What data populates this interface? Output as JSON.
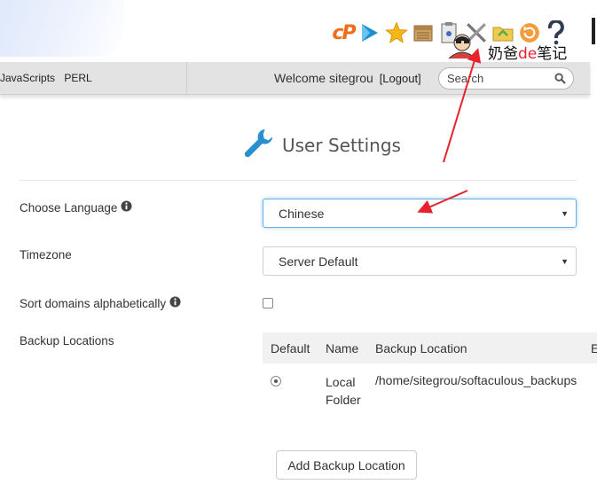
{
  "header": {
    "cpanel_logo": "cP",
    "watermark": {
      "prefix": "奶爸",
      "accent": "de",
      "suffix": "笔记"
    }
  },
  "navbar": {
    "links": [
      "JavaScripts",
      "PERL"
    ],
    "welcome_text": "Welcome sitegrou",
    "logout_label": "[Logout]",
    "search_placeholder": "Search"
  },
  "page": {
    "title": "User Settings"
  },
  "form": {
    "language": {
      "label": "Choose Language",
      "value": "Chinese"
    },
    "timezone": {
      "label": "Timezone",
      "value": "Server Default"
    },
    "sort_domains": {
      "label": "Sort domains alphabetically",
      "checked": false
    },
    "backup": {
      "label": "Backup Locations",
      "headers": [
        "Default",
        "Name",
        "Backup Location",
        "E"
      ],
      "rows": [
        {
          "default": true,
          "name": "Local Folder",
          "location": "/home/sitegrou/softaculous_backups"
        }
      ],
      "add_label": "Add Backup Location"
    }
  },
  "icons": [
    "cpanel-logo",
    "play-icon",
    "star-icon",
    "box-icon",
    "clipboard-icon",
    "tools-icon",
    "folder-icon",
    "refresh-icon",
    "help-icon",
    "info-icon",
    "search-icon",
    "wrench-icon"
  ],
  "colors": {
    "cpanel_orange": "#f06b1a",
    "wrench_blue": "#2a8fd0",
    "annotation_red": "#e8222c",
    "focus_blue": "#66afe9"
  }
}
